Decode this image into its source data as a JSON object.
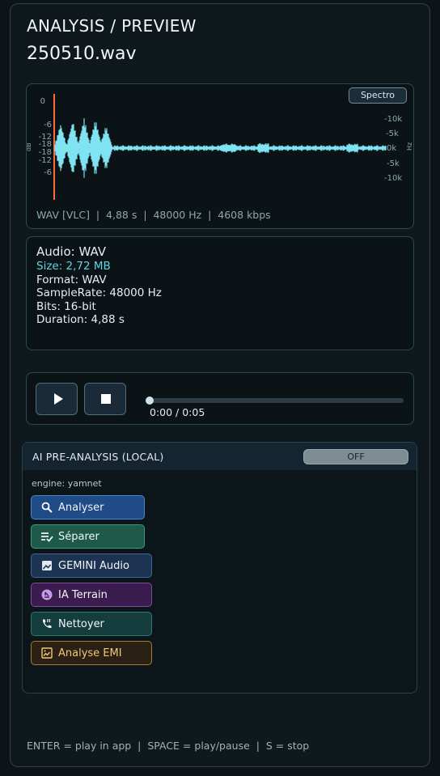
{
  "header": {
    "title": "ANALYSIS / PREVIEW",
    "file_name": "250510.wav"
  },
  "waveform": {
    "spectro_label": "Spectro",
    "db_labels": [
      "0",
      "-6",
      "-12",
      "-18",
      "-18",
      "-12",
      "-6"
    ],
    "db_unit": "dB",
    "hz_labels": [
      "-10k",
      "-5k",
      "0k",
      "-5k",
      "-10k"
    ],
    "hz_unit": "Hz",
    "zero_label": "0k",
    "info": "WAV [VLC]  |  4,88 s  |  48000 Hz  |  4608 kbps",
    "wave_color": "#7fe3f2",
    "cursor_color": "#ff6a3c"
  },
  "audio_info": {
    "title": "Audio: WAV",
    "size": "Size: 2,72 MB",
    "format": "Format: WAV",
    "samplerate": "SampleRate: 48000 Hz",
    "bits": "Bits: 16-bit",
    "duration": "Duration: 4,88 s"
  },
  "player": {
    "play_icon": "play-icon",
    "stop_icon": "stop-icon",
    "time": "0:00 / 0:05",
    "progress": 0
  },
  "ai": {
    "title": "AI PRE-ANALYSIS (LOCAL)",
    "toggle_label": "OFF",
    "engine": "engine: yamnet",
    "buttons": [
      {
        "label": "Analyser",
        "icon": "search-icon"
      },
      {
        "label": "Séparer",
        "icon": "list-check-icon"
      },
      {
        "label": "GEMINI Audio",
        "icon": "image-icon"
      },
      {
        "label": "IA Terrain",
        "icon": "terrain-icon"
      },
      {
        "label": "Nettoyer",
        "icon": "phone-call-icon"
      },
      {
        "label": "Analyse EMI",
        "icon": "photo-frame-icon"
      }
    ]
  },
  "footer": {
    "hint": "ENTER = play in app  |  SPACE = play/pause  |  S = stop"
  }
}
